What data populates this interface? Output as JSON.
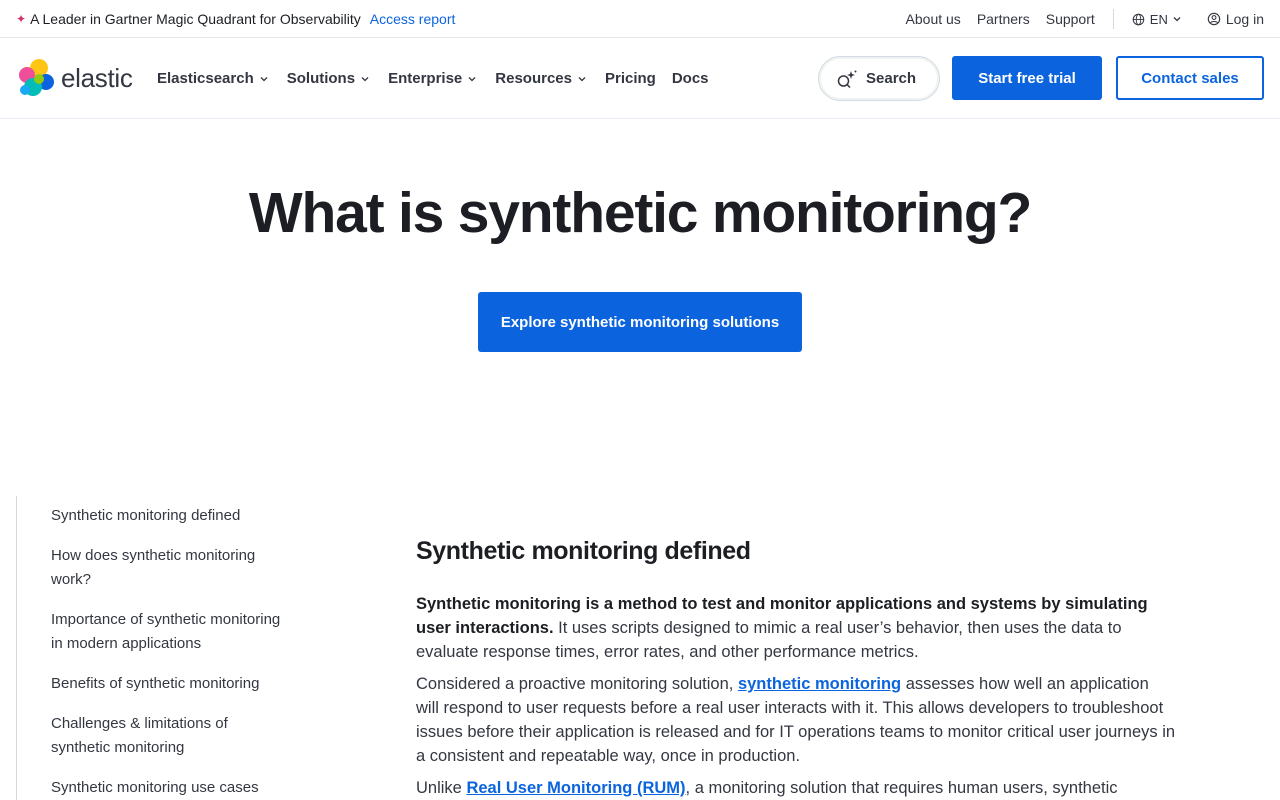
{
  "topbar": {
    "promo_text": "A Leader in Gartner Magic Quadrant for Observability",
    "promo_link": "Access report",
    "links": [
      "About us",
      "Partners",
      "Support"
    ],
    "language": "EN",
    "login": "Log in"
  },
  "nav": {
    "logo_text": "elastic",
    "menu": [
      {
        "label": "Elasticsearch",
        "dropdown": true
      },
      {
        "label": "Solutions",
        "dropdown": true
      },
      {
        "label": "Enterprise",
        "dropdown": true
      },
      {
        "label": "Resources",
        "dropdown": true
      },
      {
        "label": "Pricing",
        "dropdown": false
      },
      {
        "label": "Docs",
        "dropdown": false
      }
    ],
    "search_label": "Search",
    "trial_label": "Start free trial",
    "contact_label": "Contact sales"
  },
  "hero": {
    "title": "What is synthetic monitoring?",
    "cta": "Explore synthetic monitoring solutions"
  },
  "toc": [
    "Synthetic monitoring defined",
    "How does synthetic monitoring work?",
    "Importance of synthetic monitoring in modern applications",
    "Benefits of synthetic monitoring",
    "Challenges & limitations of synthetic monitoring",
    "Synthetic monitoring use cases"
  ],
  "article": {
    "heading": "Synthetic monitoring defined",
    "p1_bold": "Synthetic monitoring is a method to test and monitor applications and systems by simulating user interactions.",
    "p1_rest": " It uses scripts designed to mimic a real user’s behavior, then uses the data to evaluate response times, error rates, and other performance metrics.",
    "p2_start": "Considered a proactive monitoring solution, ",
    "p2_link": "synthetic monitoring",
    "p2_rest": " assesses how well an application will respond to user requests before a real user interacts with it. This allows developers to troubleshoot issues before their application is released and for IT operations teams to monitor critical user journeys in a consistent and repeatable way, once in production.",
    "p3_start": "Unlike ",
    "p3_link": "Real User Monitoring (RUM)",
    "p3_rest": ", a monitoring solution that requires human users, synthetic"
  },
  "colors": {
    "accent": "#0b64dd",
    "text": "#1c1e23",
    "sparkle": "#d6336c"
  }
}
